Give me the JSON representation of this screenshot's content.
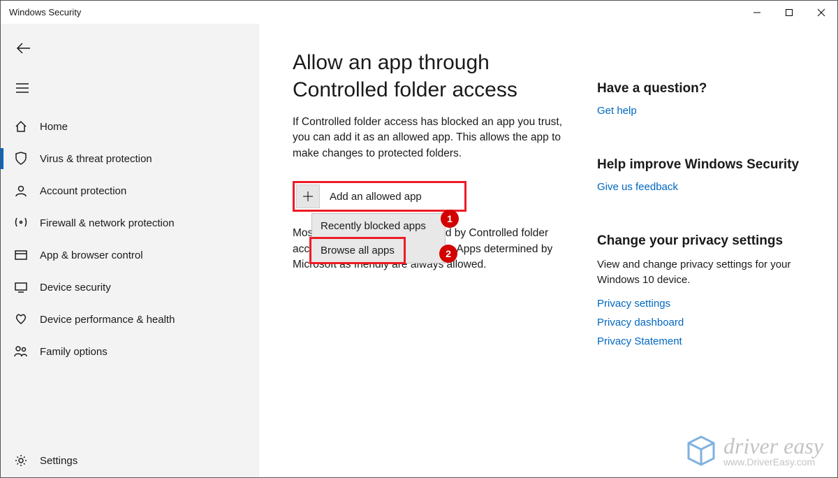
{
  "window": {
    "title": "Windows Security"
  },
  "sidebar": {
    "items": [
      {
        "label": "Home"
      },
      {
        "label": "Virus & threat protection"
      },
      {
        "label": "Account protection"
      },
      {
        "label": "Firewall & network protection"
      },
      {
        "label": "App & browser control"
      },
      {
        "label": "Device security"
      },
      {
        "label": "Device performance & health"
      },
      {
        "label": "Family options"
      }
    ],
    "settings_label": "Settings"
  },
  "main": {
    "heading": "Allow an app through Controlled folder access",
    "description": "If Controlled folder access has blocked an app you trust, you can add it as an allowed app. This allows the app to make changes to protected folders.",
    "add_button_label": "Add an allowed app",
    "dropdown_item_recent": "Recently blocked apps",
    "dropdown_item_browse": "Browse all apps",
    "secondary_text": "Most of your apps will be allowed by Controlled folder access without adding them here. Apps determined by Microsoft as friendly are always allowed."
  },
  "annotations": {
    "step1": "1",
    "step2": "2",
    "highlight_color": "#ee1c25"
  },
  "right_rail": {
    "question_heading": "Have a question?",
    "get_help": "Get help",
    "improve_heading": "Help improve Windows Security",
    "feedback": "Give us feedback",
    "privacy_heading": "Change your privacy settings",
    "privacy_body": "View and change privacy settings for your Windows 10 device.",
    "privacy_settings": "Privacy settings",
    "privacy_dashboard": "Privacy dashboard",
    "privacy_statement": "Privacy Statement"
  },
  "watermark": {
    "brand": "driver easy",
    "url": "www.DriverEasy.com"
  }
}
